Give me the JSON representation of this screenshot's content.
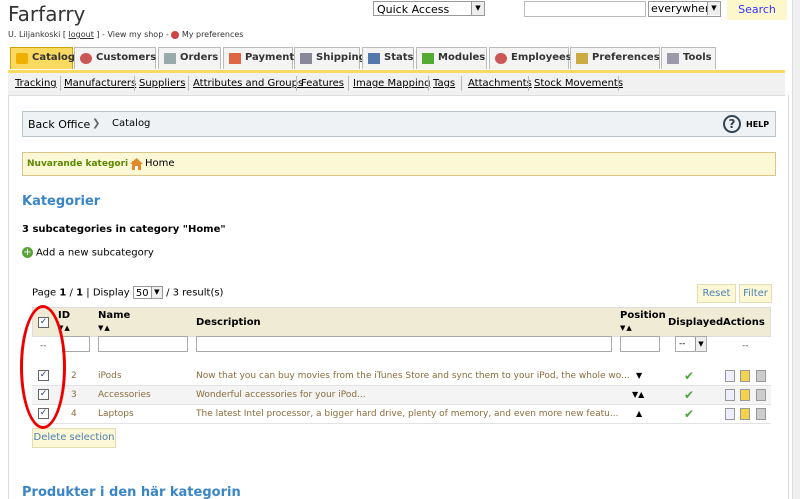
{
  "header": {
    "shop_name": "Farfarry",
    "user_name": "U. Liljankoski",
    "logout": "logout",
    "view_shop": "View my shop",
    "preferences": "My preferences",
    "quick_access": "Quick Access",
    "search_scope": "everywhere",
    "search_button": "Search"
  },
  "tabs": [
    "Catalog",
    "Customers",
    "Orders",
    "Payment",
    "Shipping",
    "Stats",
    "Modules",
    "Employees",
    "Preferences",
    "Tools"
  ],
  "subnav": [
    "Tracking",
    "Manufacturers",
    "Suppliers",
    "Attributes and Groups",
    "Features",
    "Image Mapping",
    "Tags",
    "Attachments",
    "Stock Movements"
  ],
  "breadcrumb": {
    "root": "Back Office",
    "current": "Catalog",
    "help": "HELP"
  },
  "current_category": {
    "label": "Nuvarande kategori :",
    "value": "Home"
  },
  "section_title": "Kategorier",
  "subcat_count": "3 subcategories in category \"Home\"",
  "add_subcategory": "Add a new subcategory",
  "pager": {
    "page_label": "Page",
    "current": "1",
    "total": "1",
    "display_label": "| Display",
    "per_page": "50",
    "results": "/ 3 result(s)"
  },
  "buttons": {
    "reset": "Reset",
    "filter": "Filter",
    "delete": "Delete selection"
  },
  "columns": {
    "id": "ID",
    "name": "Name",
    "description": "Description",
    "position": "Position",
    "displayed": "Displayed",
    "actions": "Actions"
  },
  "filter": {
    "dash": "--",
    "displayed_select": "--"
  },
  "rows": [
    {
      "id": "2",
      "name": "iPods",
      "description": "Now that you can buy movies from the iTunes Store and sync them to your iPod, the whole wo...",
      "position_arrows": "▼"
    },
    {
      "id": "3",
      "name": "Accessories",
      "description": "Wonderful accessories for your iPod...",
      "position_arrows": "▼▲"
    },
    {
      "id": "4",
      "name": "Laptops",
      "description": "The latest Intel processor, a bigger hard drive, plenty of memory, and even more new featu...",
      "position_arrows": "▲"
    }
  ],
  "products_title": "Produkter i den här kategorin",
  "colors": {
    "tab_active": "#f9d960",
    "link_blue": "#3a85c6",
    "row_text": "#8a6d3b",
    "annotation_red": "#e00000"
  }
}
